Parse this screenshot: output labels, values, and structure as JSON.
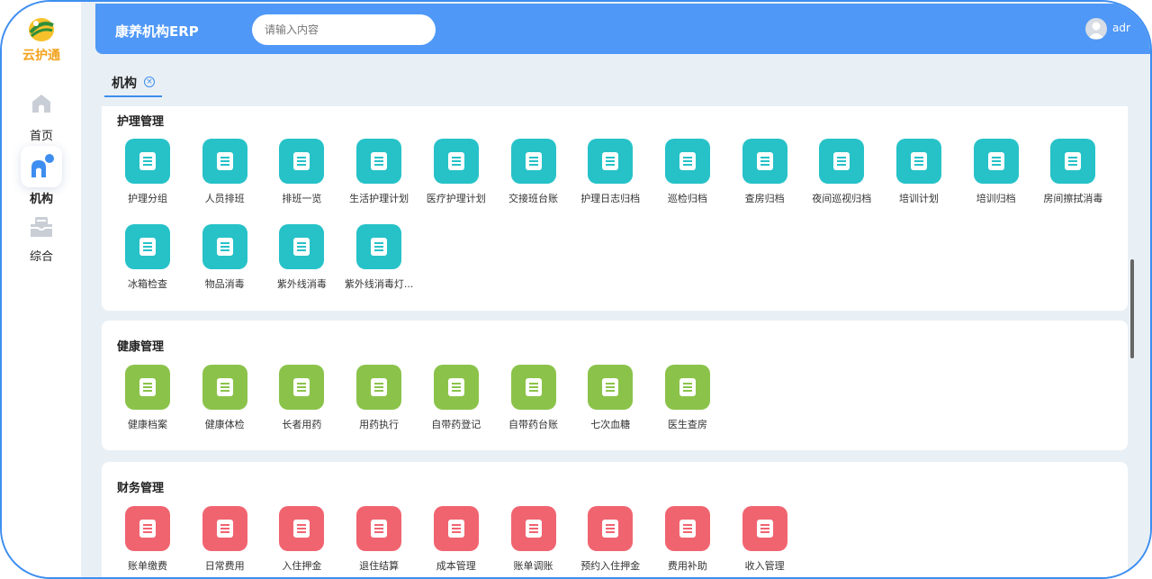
{
  "app": {
    "title": "康养机构ERP"
  },
  "logo": {
    "text": "云护通"
  },
  "search": {
    "placeholder": "请输入内容"
  },
  "user": {
    "name": "adm"
  },
  "sidebar": {
    "items": [
      {
        "label": "首页",
        "icon": "home-icon"
      },
      {
        "label": "机构",
        "icon": "institution-icon",
        "active": true
      },
      {
        "label": "综合",
        "icon": "inbox-icon"
      }
    ]
  },
  "tabs": [
    {
      "label": "机构",
      "close": "×"
    }
  ],
  "colors": {
    "accent": "#4f98f7",
    "teal": "#26c2c8",
    "green": "#8bc34a",
    "red": "#f06470"
  },
  "sections": [
    {
      "title": "护理管理",
      "items": [
        {
          "label": "护理分组",
          "icon": "nursing-group-icon"
        },
        {
          "label": "人员排班",
          "icon": "calendar-add-icon"
        },
        {
          "label": "排班一览",
          "icon": "calendar-view-icon"
        },
        {
          "label": "生活护理计划",
          "icon": "care-plan-icon"
        },
        {
          "label": "医疗护理计划",
          "icon": "medical-plan-icon"
        },
        {
          "label": "交接班台账",
          "icon": "handover-ledger-icon"
        },
        {
          "label": "护理日志归档",
          "icon": "nursing-log-icon"
        },
        {
          "label": "巡检归档",
          "icon": "inspection-icon"
        },
        {
          "label": "查房归档",
          "icon": "ward-round-icon"
        },
        {
          "label": "夜间巡视归档",
          "icon": "night-patrol-icon"
        },
        {
          "label": "培训计划",
          "icon": "training-plan-icon"
        },
        {
          "label": "培训归档",
          "icon": "training-archive-icon"
        },
        {
          "label": "房间擦拭消毒",
          "icon": "room-disinfect-icon"
        },
        {
          "label": "冰箱检查",
          "icon": "fridge-check-icon"
        },
        {
          "label": "物品消毒",
          "icon": "item-disinfect-icon"
        },
        {
          "label": "紫外线消毒",
          "icon": "uv-disinfect-icon"
        },
        {
          "label": "紫外线消毒灯...",
          "icon": "uv-lamp-icon"
        }
      ]
    },
    {
      "title": "健康管理",
      "items": [
        {
          "label": "健康档案",
          "icon": "health-folder-icon"
        },
        {
          "label": "健康体检",
          "icon": "checkup-icon"
        },
        {
          "label": "长者用药",
          "icon": "lungs-icon"
        },
        {
          "label": "用药执行",
          "icon": "pill-clock-icon"
        },
        {
          "label": "自带药登记",
          "icon": "medicine-bottle-icon"
        },
        {
          "label": "自带药台账",
          "icon": "medicine-ledger-icon"
        },
        {
          "label": "七次血糖",
          "icon": "blood-sugar-icon"
        },
        {
          "label": "医生查房",
          "icon": "doctor-round-icon"
        }
      ]
    },
    {
      "title": "财务管理",
      "items": [
        {
          "label": "账单缴费",
          "icon": "bill-payment-icon"
        },
        {
          "label": "日常费用",
          "icon": "daily-expense-icon"
        },
        {
          "label": "入住押金",
          "icon": "deposit-icon"
        },
        {
          "label": "退住结算",
          "icon": "checkout-settle-icon"
        },
        {
          "label": "成本管理",
          "icon": "cost-icon"
        },
        {
          "label": "账单调账",
          "icon": "bill-adjust-icon"
        },
        {
          "label": "预约入住押金",
          "icon": "reserve-deposit-icon"
        },
        {
          "label": "费用补助",
          "icon": "subsidy-icon"
        },
        {
          "label": "收入管理",
          "icon": "income-icon"
        }
      ]
    }
  ]
}
